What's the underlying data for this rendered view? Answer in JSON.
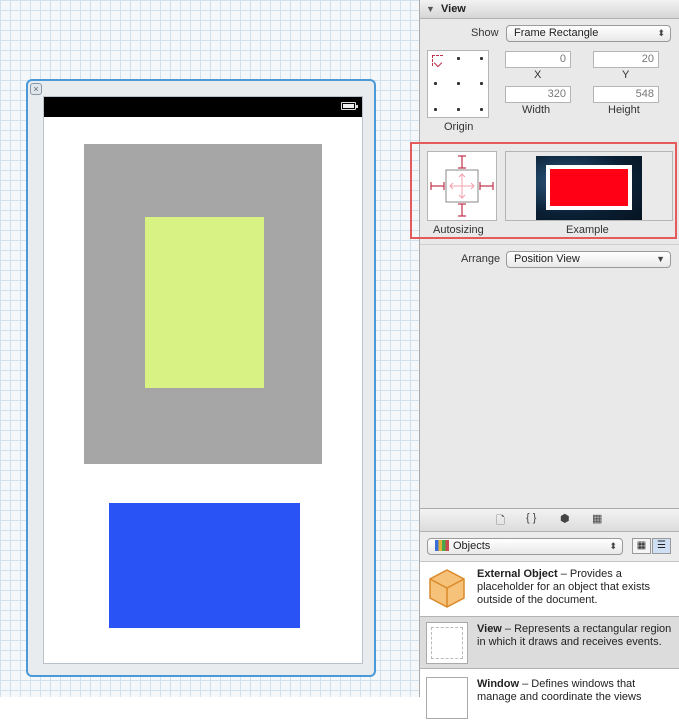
{
  "inspector": {
    "section_title": "View",
    "show_label": "Show",
    "show_value": "Frame Rectangle",
    "x_value": "0",
    "y_value": "20",
    "x_label": "X",
    "y_label": "Y",
    "width_value": "320",
    "height_value": "548",
    "width_label": "Width",
    "height_label": "Height",
    "origin_label": "Origin",
    "autosizing_label": "Autosizing",
    "example_label": "Example",
    "arrange_label": "Arrange",
    "arrange_value": "Position View"
  },
  "library": {
    "tabs": [
      "🗋",
      "{ }",
      "⬢",
      "▦"
    ],
    "selector_value": "Objects",
    "items": [
      {
        "title": "External Object",
        "desc": " – Provides a placeholder for an object that exists outside of the document."
      },
      {
        "title": "View",
        "desc": " – Represents a rectangular region in which it draws and receives events."
      },
      {
        "title": "Window",
        "desc": " – Defines windows that manage and coordinate the views"
      }
    ]
  },
  "colors": {
    "gray_view": "#a6a6a6",
    "green_view": "#d9f284",
    "blue_view": "#2953f5",
    "example_red": "#ff0015",
    "highlight": "#e55a5a"
  }
}
